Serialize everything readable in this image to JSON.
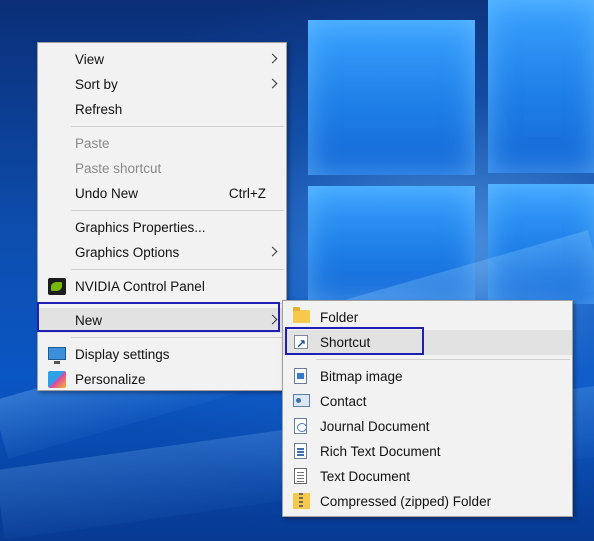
{
  "context_menu": {
    "items": [
      {
        "label": "View"
      },
      {
        "label": "Sort by"
      },
      {
        "label": "Refresh"
      },
      {
        "label": "Paste"
      },
      {
        "label": "Paste shortcut"
      },
      {
        "label": "Undo New",
        "shortcut": "Ctrl+Z"
      },
      {
        "label": "Graphics Properties..."
      },
      {
        "label": "Graphics Options"
      },
      {
        "label": "NVIDIA Control Panel"
      },
      {
        "label": "New"
      },
      {
        "label": "Display settings"
      },
      {
        "label": "Personalize"
      }
    ]
  },
  "new_submenu": {
    "items": [
      {
        "label": "Folder"
      },
      {
        "label": "Shortcut"
      },
      {
        "label": "Bitmap image"
      },
      {
        "label": "Contact"
      },
      {
        "label": "Journal Document"
      },
      {
        "label": "Rich Text Document"
      },
      {
        "label": "Text Document"
      },
      {
        "label": "Compressed (zipped) Folder"
      }
    ]
  },
  "icons": {
    "nvidia": "nvidia-icon",
    "display": "display-settings-icon",
    "personalize": "personalize-icon",
    "folder": "folder-icon",
    "shortcut": "shortcut-icon",
    "bitmap": "bitmap-image-icon",
    "contact": "contact-icon",
    "journal": "journal-document-icon",
    "rtf": "rich-text-document-icon",
    "text": "text-document-icon",
    "zip": "zip-folder-icon"
  },
  "colors": {
    "menu_bg": "#f2f2f2",
    "highlight_bg": "#e2e2e2",
    "selection_outline": "#1f1fb5",
    "disabled_text": "#8a8a8a",
    "wallpaper_blue": "#0d4fb0"
  }
}
